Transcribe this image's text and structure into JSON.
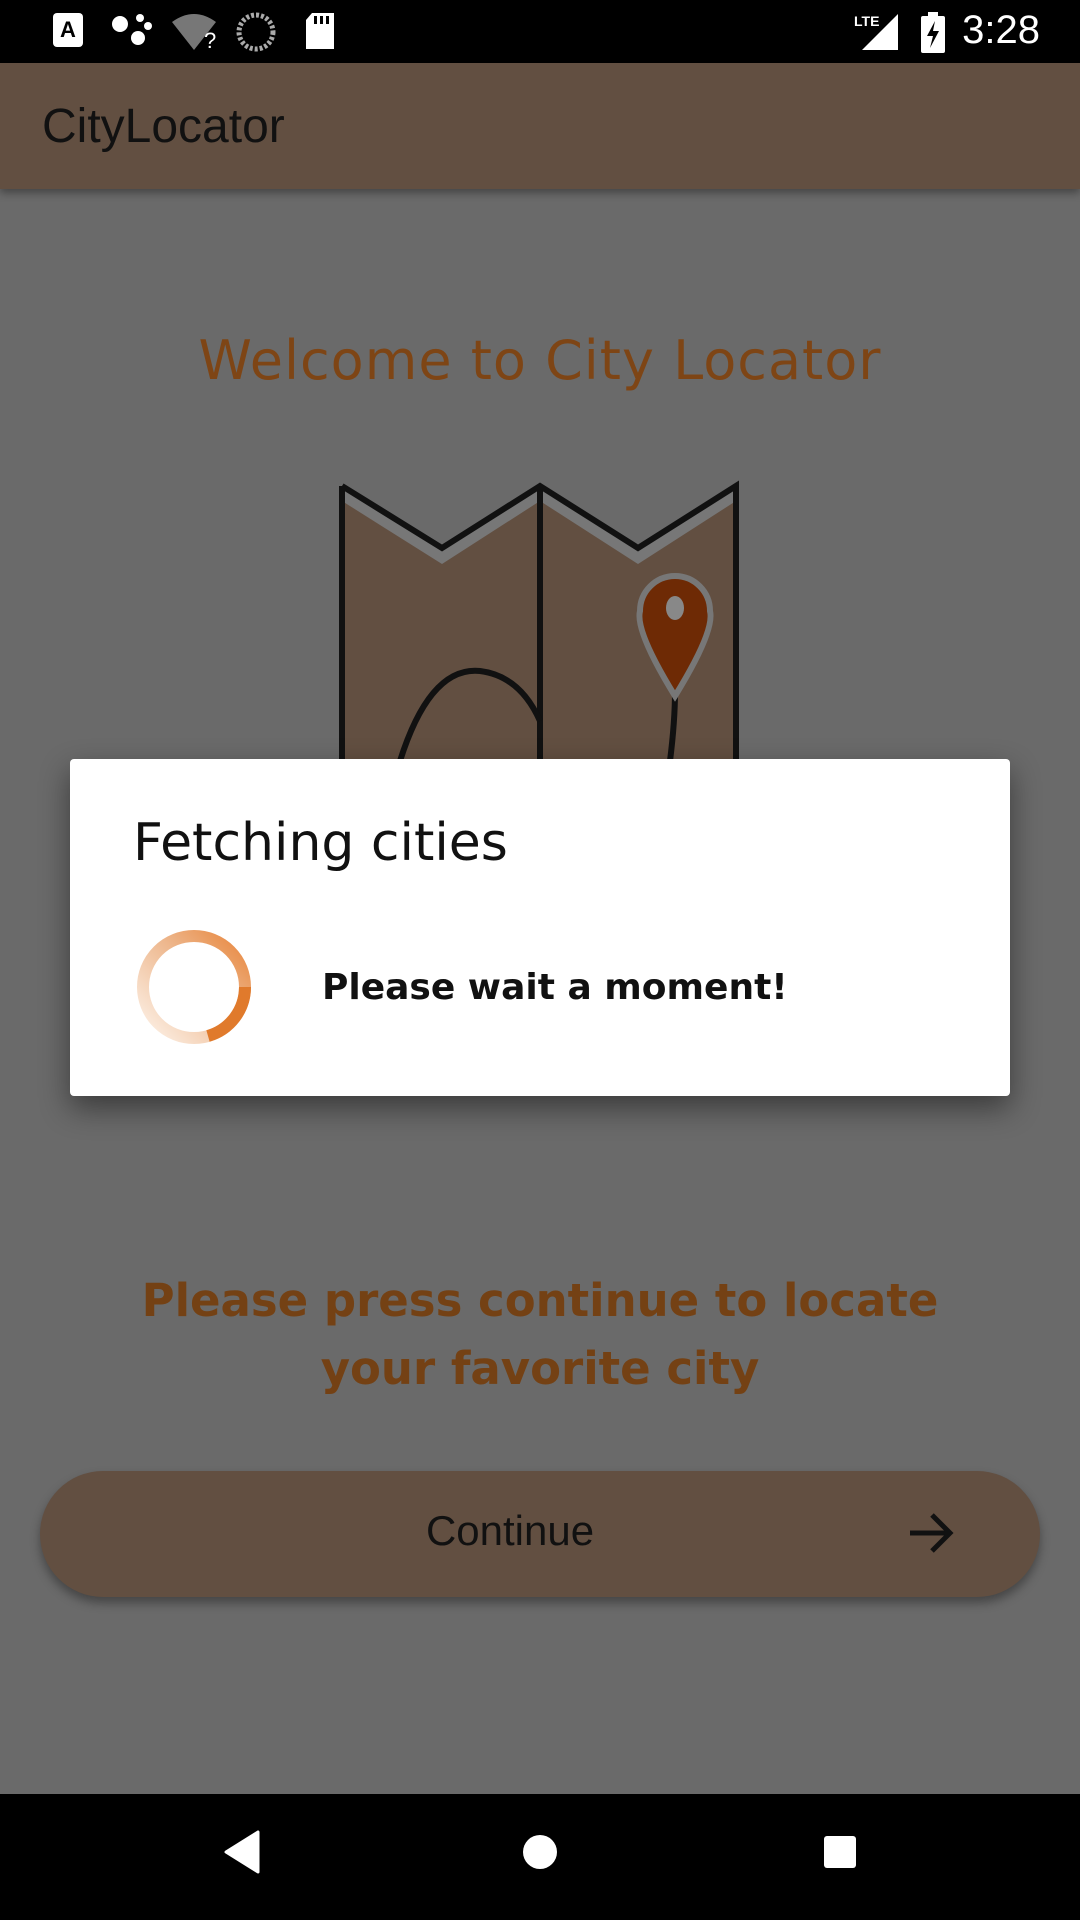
{
  "status_bar": {
    "time": "3:28",
    "icons": [
      "a-icon",
      "dots-icon",
      "wifi-question-icon",
      "sync-icon",
      "sdcard-icon",
      "lte-signal-icon",
      "battery-charging-icon"
    ],
    "network": "LTE"
  },
  "app_bar": {
    "title": "CityLocator"
  },
  "main": {
    "welcome": "Welcome to City Locator",
    "illustration": "map-with-pin-icon",
    "instruction": "Please press continue to locate your favorite city",
    "continue_label": "Continue"
  },
  "dialog": {
    "title": "Fetching cities",
    "message": "Please wait a moment!"
  },
  "nav_bar": {
    "icons": [
      "back-icon",
      "home-icon",
      "recents-icon"
    ]
  },
  "colors": {
    "accent_text": "#7e4515",
    "brand_brown": "#624f41",
    "spinner": "#e8863c"
  }
}
